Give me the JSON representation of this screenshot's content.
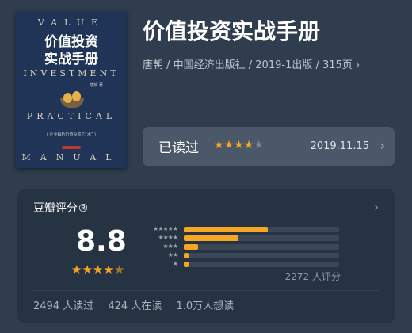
{
  "book": {
    "title": "价值投资实战手册",
    "meta": "唐朝 / 中国经济出版社 / 2019-1出版 / 315页",
    "meta_chevron": "›",
    "cover": {
      "en_line1": "VALUE",
      "cn_line1": "价值投资",
      "cn_line2": "实战手册",
      "en_line2": "INVESTMENT",
      "author": "唐朝 著",
      "en_line3": "PRACTICAL",
      "subtitle": "( 企业解析价值投资之“术” )",
      "en_line4": "MANUAL",
      "colors": {
        "bg": "#1f3456",
        "egg": "#e7b24a"
      }
    }
  },
  "my_status": {
    "label": "已读过",
    "stars": "★★★★★",
    "star_rating": 4,
    "date": "2019.11.15",
    "chevron": "›"
  },
  "douban_rating": {
    "header": "豆瓣评分®",
    "chevron": "›",
    "score": "8.8",
    "score_stars": "★★★★★",
    "score_star_value": 4.5,
    "distribution": [
      {
        "stars": "★★★★★",
        "fraction": 0.54
      },
      {
        "stars": "★★★★",
        "fraction": 0.35
      },
      {
        "stars": "★★★",
        "fraction": 0.09
      },
      {
        "stars": "★★",
        "fraction": 0.03
      },
      {
        "stars": "★",
        "fraction": 0.03
      }
    ],
    "rating_count": "2272 人评分",
    "stats": [
      "2494 人读过",
      "424 人在读",
      "1.0万人想读"
    ]
  },
  "colors": {
    "background": "#2f3d4f",
    "accent_star": "#f6a623",
    "card": "#4a5869",
    "rating_card": "#263343"
  }
}
